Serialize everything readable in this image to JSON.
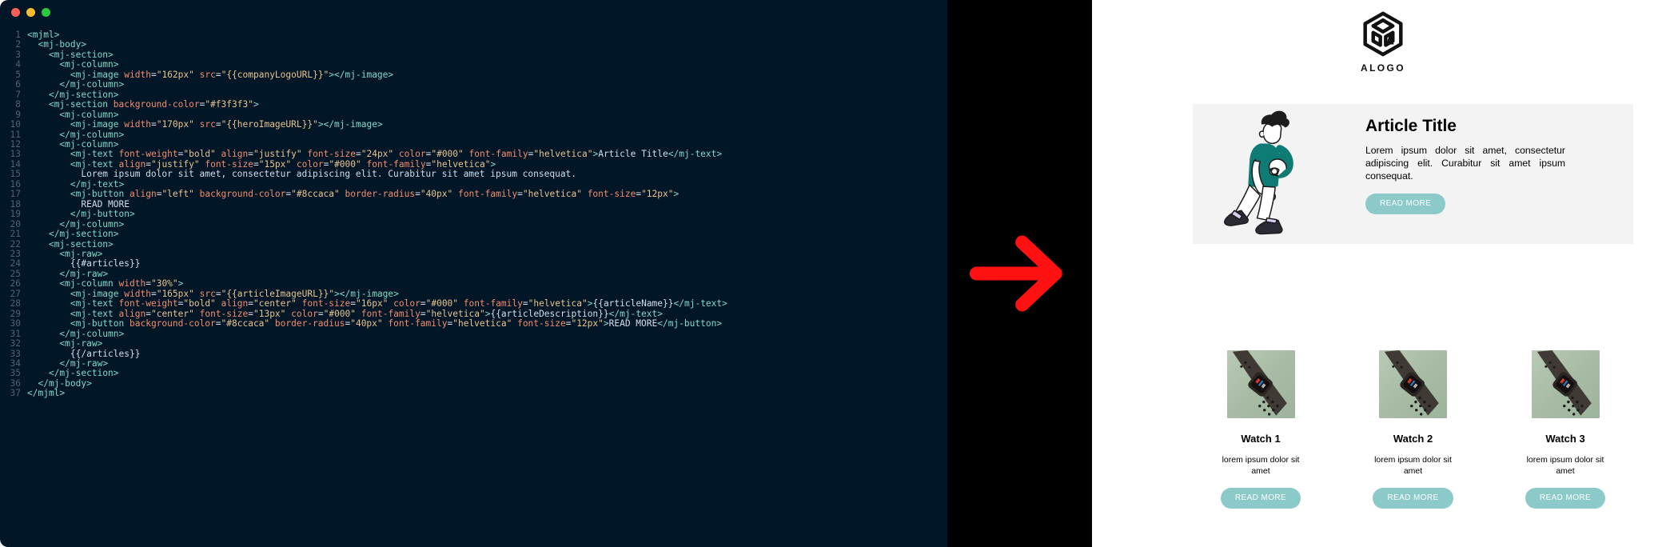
{
  "window": {
    "controls": [
      {
        "name": "close",
        "color": "#ff5f57"
      },
      {
        "name": "minimize",
        "color": "#febc2e"
      },
      {
        "name": "maximize",
        "color": "#28c840"
      }
    ]
  },
  "editor": {
    "language": "mjml",
    "theme_background": "#011627",
    "colors": {
      "tag": "#7fdbca",
      "attribute": "#f78c6c",
      "string": "#ecc48d",
      "text": "#d6deeb",
      "line_number": "#4b6479"
    },
    "lines": [
      {
        "n": "1",
        "raw": "<mjml>"
      },
      {
        "n": "2",
        "raw": "  <mj-body>"
      },
      {
        "n": "3",
        "raw": "    <mj-section>"
      },
      {
        "n": "4",
        "raw": "      <mj-column>"
      },
      {
        "n": "5",
        "raw": "        <mj-image width=\"162px\" src=\"{{companyLogoURL}}\"></mj-image>"
      },
      {
        "n": "6",
        "raw": "      </mj-column>"
      },
      {
        "n": "7",
        "raw": "    </mj-section>"
      },
      {
        "n": "8",
        "raw": "    <mj-section background-color=\"#f3f3f3\">"
      },
      {
        "n": "9",
        "raw": "      <mj-column>"
      },
      {
        "n": "10",
        "raw": "        <mj-image width=\"170px\" src=\"{{heroImageURL}}\"></mj-image>"
      },
      {
        "n": "11",
        "raw": "      </mj-column>"
      },
      {
        "n": "12",
        "raw": "      <mj-column>"
      },
      {
        "n": "13",
        "raw": "        <mj-text font-weight=\"bold\" align=\"justify\" font-size=\"24px\" color=\"#000\" font-family=\"helvetica\">Article Title</mj-text>"
      },
      {
        "n": "14",
        "raw": "        <mj-text align=\"justify\" font-size=\"15px\" color=\"#000\" font-family=\"helvetica\">"
      },
      {
        "n": "15",
        "raw": "          Lorem ipsum dolor sit amet, consectetur adipiscing elit. Curabitur sit amet ipsum consequat."
      },
      {
        "n": "16",
        "raw": "        </mj-text>"
      },
      {
        "n": "17",
        "raw": "        <mj-button align=\"left\" background-color=\"#8ccaca\" border-radius=\"40px\" font-family=\"helvetica\" font-size=\"12px\">"
      },
      {
        "n": "18",
        "raw": "          READ MORE"
      },
      {
        "n": "19",
        "raw": "        </mj-button>"
      },
      {
        "n": "20",
        "raw": "      </mj-column>"
      },
      {
        "n": "21",
        "raw": "    </mj-section>"
      },
      {
        "n": "22",
        "raw": "    <mj-section>"
      },
      {
        "n": "23",
        "raw": "      <mj-raw>"
      },
      {
        "n": "24",
        "raw": "        {{#articles}}"
      },
      {
        "n": "25",
        "raw": "      </mj-raw>"
      },
      {
        "n": "26",
        "raw": "      <mj-column width=\"30%\">"
      },
      {
        "n": "27",
        "raw": "        <mj-image width=\"165px\" src=\"{{articleImageURL}}\"></mj-image>"
      },
      {
        "n": "28",
        "raw": "        <mj-text font-weight=\"bold\" align=\"center\" font-size=\"16px\" color=\"#000\" font-family=\"helvetica\">{{articleName}}</mj-text>"
      },
      {
        "n": "29",
        "raw": "        <mj-text align=\"center\" font-size=\"13px\" color=\"#000\" font-family=\"helvetica\">{{articleDescription}}</mj-text>"
      },
      {
        "n": "30",
        "raw": "        <mj-button background-color=\"#8ccaca\" border-radius=\"40px\" font-family=\"helvetica\" font-size=\"12px\">READ MORE</mj-button>"
      },
      {
        "n": "31",
        "raw": "      </mj-column>"
      },
      {
        "n": "32",
        "raw": "      <mj-raw>"
      },
      {
        "n": "33",
        "raw": "        {{/articles}}"
      },
      {
        "n": "34",
        "raw": "      </mj-raw>"
      },
      {
        "n": "35",
        "raw": "    </mj-section>"
      },
      {
        "n": "36",
        "raw": "  </mj-body>"
      },
      {
        "n": "37",
        "raw": "</mjml>"
      }
    ]
  },
  "divider": {
    "icon": "right-arrow-icon",
    "arrow_color": "#ff1111",
    "background": "#000000"
  },
  "preview": {
    "logo": {
      "icon": "cube-logo-icon",
      "wordmark": "ALOGO",
      "color": "#111111"
    },
    "hero": {
      "background": "#f3f3f3",
      "illustration": "walking-person-illustration",
      "title": "Article Title",
      "body": "Lorem ipsum dolor sit amet, consectetur adipiscing elit. Curabitur sit amet ipsum consequat.",
      "button_label": "READ MORE",
      "button_color": "#8ccaca"
    },
    "cards": [
      {
        "image": "watch-photo",
        "title": "Watch 1",
        "description": "lorem ipsum dolor sit amet",
        "button_label": "READ MORE"
      },
      {
        "image": "watch-photo",
        "title": "Watch 2",
        "description": "lorem ipsum dolor sit amet",
        "button_label": "READ MORE"
      },
      {
        "image": "watch-photo",
        "title": "Watch 3",
        "description": "lorem ipsum dolor sit amet",
        "button_label": "READ MORE"
      }
    ]
  }
}
